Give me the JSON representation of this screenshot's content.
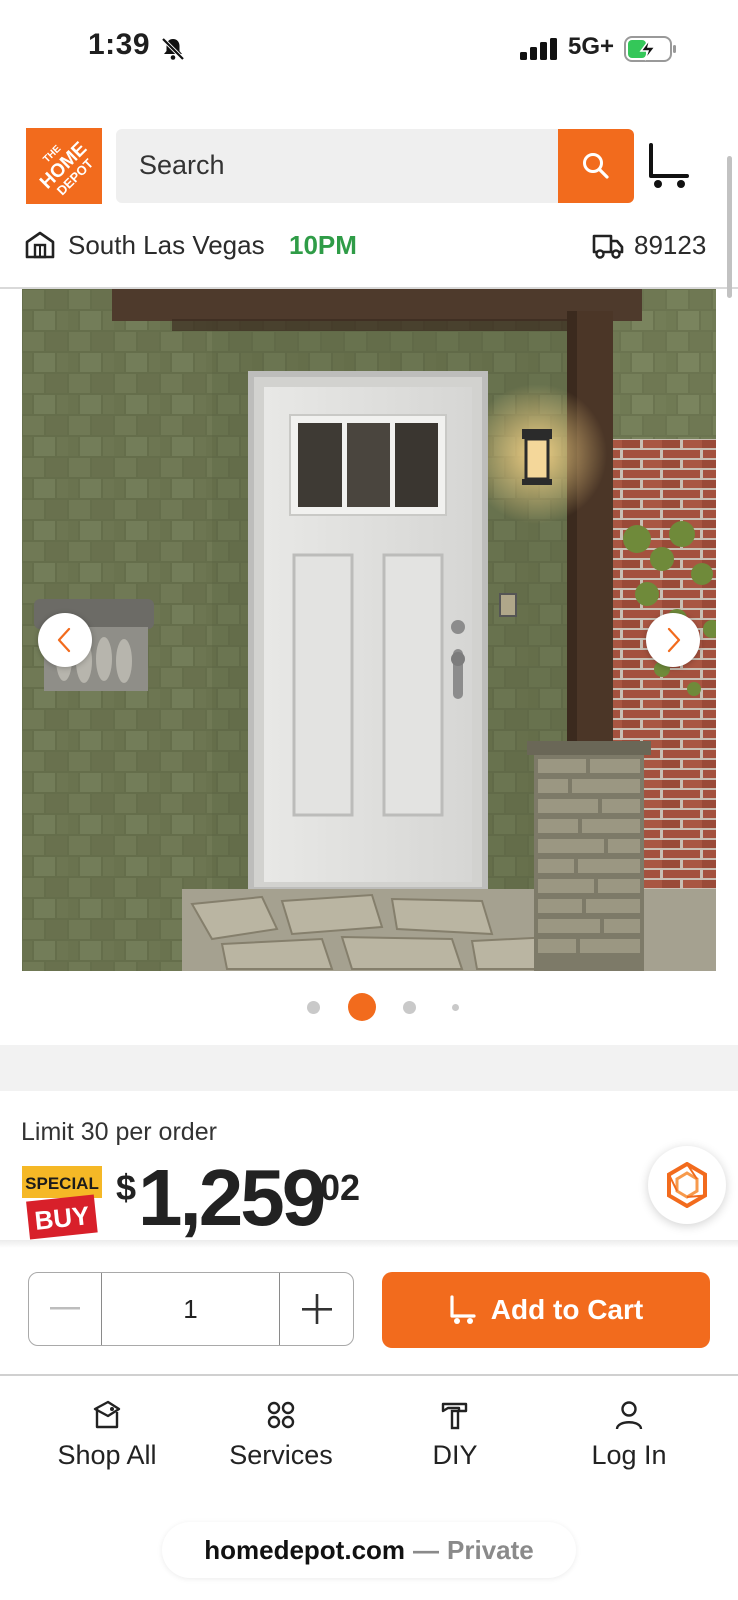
{
  "status_bar": {
    "time": "1:39",
    "network": "5G+"
  },
  "header": {
    "logo_text": "THE HOME DEPOT",
    "search_placeholder": "Search",
    "store_name": "South Las Vegas",
    "store_hours": "10PM",
    "zip_code": "89123"
  },
  "gallery": {
    "image_count": 4,
    "active_index": 1
  },
  "product": {
    "limit_text": "Limit 30 per order",
    "badge_line1": "SPECIAL",
    "badge_line2": "BUY",
    "price_symbol": "$",
    "price_whole": "1,259",
    "price_cents": "02"
  },
  "cart_bar": {
    "quantity": "1",
    "add_to_cart_label": "Add to Cart"
  },
  "bottom_nav": {
    "items": [
      {
        "label": "Shop All",
        "icon": "tag-icon"
      },
      {
        "label": "Services",
        "icon": "grid-icon"
      },
      {
        "label": "DIY",
        "icon": "hammer-icon"
      },
      {
        "label": "Log In",
        "icon": "person-icon"
      }
    ]
  },
  "browser": {
    "domain": "homedepot.com",
    "separator": "—",
    "mode": "Private"
  },
  "colors": {
    "brand_orange": "#f26b1d",
    "open_green": "#2f9c47"
  }
}
